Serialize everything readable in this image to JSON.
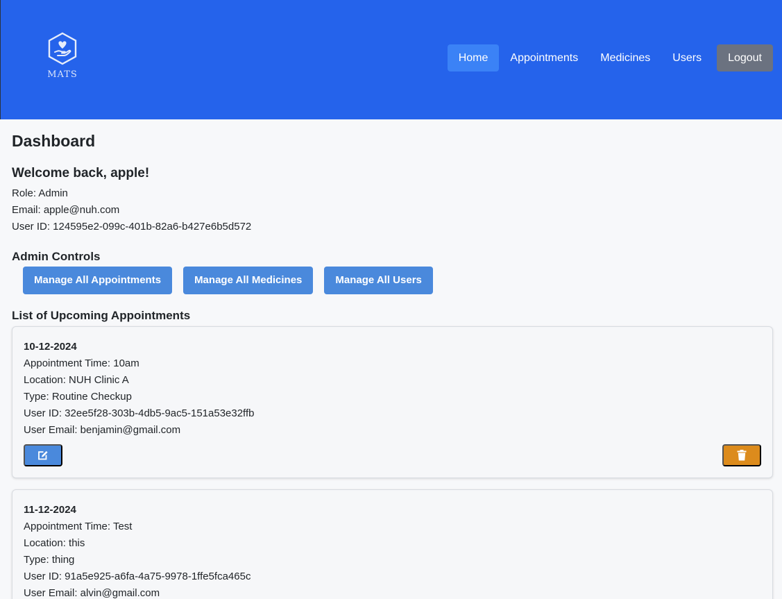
{
  "brand": {
    "name": "MATS",
    "logo_icon": "hand-heart-hexagon-icon"
  },
  "nav": {
    "items": [
      {
        "label": "Home",
        "active": true
      },
      {
        "label": "Appointments",
        "active": false
      },
      {
        "label": "Medicines",
        "active": false
      },
      {
        "label": "Users",
        "active": false
      }
    ],
    "logout_label": "Logout"
  },
  "dashboard": {
    "title": "Dashboard",
    "welcome": "Welcome back, apple!",
    "role": "Role: Admin",
    "email": "Email: apple@nuh.com",
    "user_id": "User ID: 124595e2-099c-401b-82a6-b427e6b5d572"
  },
  "admin_controls": {
    "title": "Admin Controls",
    "buttons": [
      "Manage All Appointments",
      "Manage All Medicines",
      "Manage All Users"
    ]
  },
  "appointments": {
    "title": "List of Upcoming Appointments",
    "items": [
      {
        "date": "10-12-2024",
        "time": "Appointment Time: 10am",
        "location": "Location: NUH Clinic A",
        "type": "Type: Routine Checkup",
        "user_id": "User ID: 32ee5f28-303b-4db5-9ac5-151a53e32ffb",
        "user_email": "User Email: benjamin@gmail.com"
      },
      {
        "date": "11-12-2024",
        "time": "Appointment Time: Test",
        "location": "Location: this",
        "type": "Type: thing",
        "user_id": "User ID: 91a5e925-a6fa-4a75-9978-1ffe5fca465c",
        "user_email": "User Email: alvin@gmail.com"
      }
    ]
  },
  "colors": {
    "navbar": "#2563eb",
    "nav_active": "#3b82f6",
    "logout": "#6b7280",
    "primary_button": "#4a89dc",
    "delete_button": "#dc8b1c"
  }
}
